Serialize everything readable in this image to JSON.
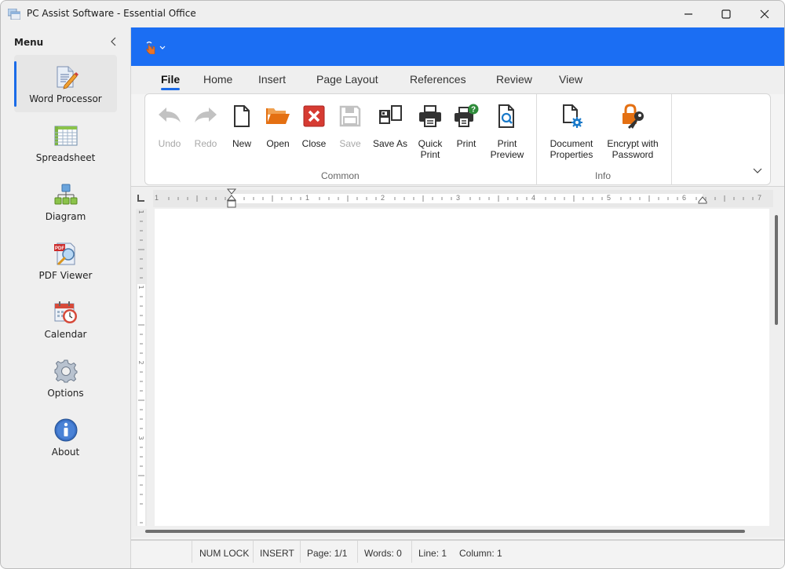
{
  "window": {
    "title": "PC Assist Software - Essential Office",
    "controls": [
      "minimize",
      "maximize",
      "close"
    ]
  },
  "sidebar": {
    "title": "Menu",
    "items": [
      {
        "label": "Word Processor",
        "icon": "word-processor-icon",
        "active": true
      },
      {
        "label": "Spreadsheet",
        "icon": "spreadsheet-icon",
        "active": false
      },
      {
        "label": "Diagram",
        "icon": "diagram-icon",
        "active": false
      },
      {
        "label": "PDF Viewer",
        "icon": "pdf-viewer-icon",
        "active": false
      },
      {
        "label": "Calendar",
        "icon": "calendar-icon",
        "active": false
      },
      {
        "label": "Options",
        "icon": "gear-icon",
        "active": false
      },
      {
        "label": "About",
        "icon": "info-icon",
        "active": false
      }
    ]
  },
  "ribbon": {
    "tabs": [
      {
        "label": "File",
        "active": true
      },
      {
        "label": "Home"
      },
      {
        "label": "Insert"
      },
      {
        "label": "Page Layout"
      },
      {
        "label": "References"
      },
      {
        "label": "Review"
      },
      {
        "label": "View"
      }
    ],
    "groups": [
      {
        "label": "Common",
        "buttons": [
          {
            "label": "Undo",
            "disabled": true
          },
          {
            "label": "Redo",
            "disabled": true
          },
          {
            "label": "New"
          },
          {
            "label": "Open"
          },
          {
            "label": "Close"
          },
          {
            "label": "Save",
            "disabled": true
          },
          {
            "label": "Save As"
          },
          {
            "label": "Quick\nPrint"
          },
          {
            "label": "Print"
          },
          {
            "label": "Print\nPreview"
          }
        ]
      },
      {
        "label": "Info",
        "buttons": [
          {
            "label": "Document\nProperties"
          },
          {
            "label": "Encrypt with\nPassword"
          }
        ]
      }
    ]
  },
  "ruler": {
    "horizontal_numbers": [
      "1",
      "1",
      "2",
      "3",
      "4",
      "5",
      "6",
      "7"
    ],
    "vertical_numbers": [
      "1",
      "1",
      "2",
      "3"
    ]
  },
  "status": {
    "num_lock": "NUM LOCK",
    "insert": "INSERT",
    "page": "Page: 1/1",
    "words": "Words: 0",
    "line": "Line: 1",
    "column": "Column: 1"
  },
  "colors": {
    "accent": "#1b6ef3"
  }
}
